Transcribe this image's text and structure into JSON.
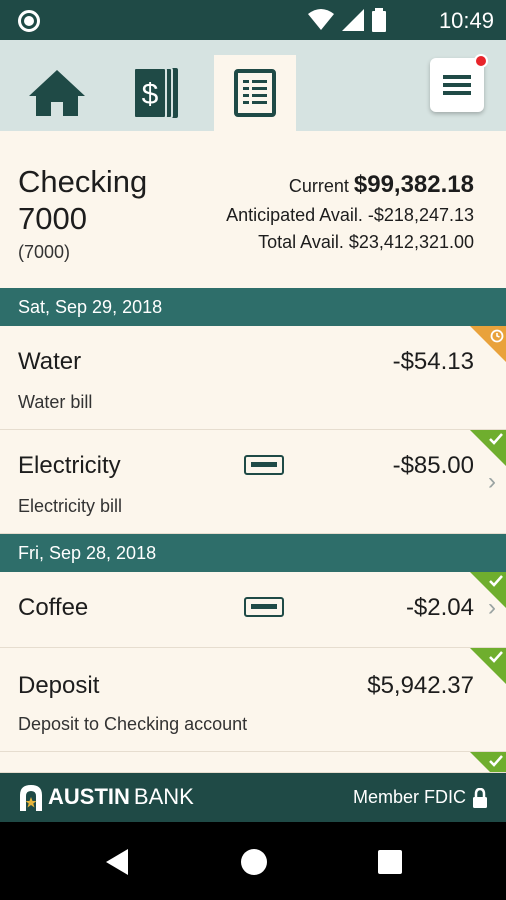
{
  "status_bar": {
    "time": "10:49"
  },
  "toolbar": {
    "tabs": [
      {
        "name": "home",
        "icon": "home-icon"
      },
      {
        "name": "accounts",
        "icon": "dollar-bills-icon"
      },
      {
        "name": "transactions",
        "icon": "document-list-icon",
        "active": true
      }
    ],
    "menu_icon": "hamburger-menu-icon"
  },
  "account": {
    "name_line1": "Checking",
    "name_line2": "7000",
    "number": "(7000)",
    "current_label": "Current",
    "current_value": "$99,382.18",
    "anticipated_label": "Anticipated Avail.",
    "anticipated_value": "-$218,247.13",
    "total_label": "Total Avail.",
    "total_value": "$23,412,321.00"
  },
  "groups": [
    {
      "date": "Sat, Sep 29, 2018",
      "transactions": [
        {
          "name": "Water",
          "description": "Water bill",
          "amount": "-$54.13",
          "status": "pending"
        },
        {
          "name": "Electricity",
          "description": "Electricity bill",
          "amount": "-$85.00",
          "status": "cleared",
          "has_card": true
        }
      ]
    },
    {
      "date": "Fri, Sep 28, 2018",
      "transactions": [
        {
          "name": "Coffee",
          "description": "",
          "amount": "-$2.04",
          "status": "cleared",
          "has_card": true
        },
        {
          "name": "Deposit",
          "description": "Deposit to Checking account",
          "amount": "$5,942.37",
          "status": "cleared"
        }
      ]
    }
  ],
  "footer": {
    "logo_word1": "AUSTIN",
    "logo_word2": "BANK",
    "fdic": "Member FDIC"
  },
  "colors": {
    "primary_dark": "#1f4a46",
    "date_bar": "#2e6e6a",
    "cleared": "#6fae2e",
    "pending": "#e9a23b",
    "background": "#fcf6ec"
  }
}
